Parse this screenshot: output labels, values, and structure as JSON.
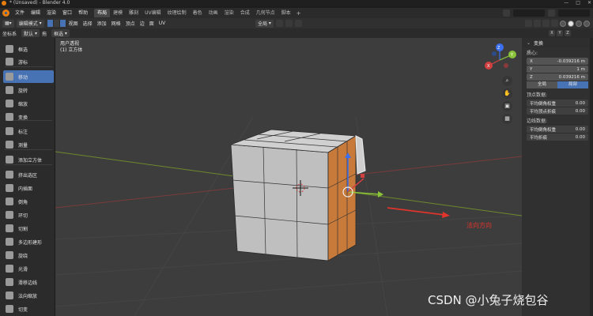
{
  "window": {
    "title": "* (Unsaved) - Blender 4.0",
    "controls": [
      "—",
      "□",
      "✕"
    ]
  },
  "menubar": {
    "menus": [
      "文件",
      "编辑",
      "渲染",
      "窗口",
      "帮助"
    ],
    "workspaces": [
      "布局",
      "建模",
      "雕刻",
      "UV编辑",
      "纹理绘制",
      "着色",
      "动画",
      "渲染",
      "合成",
      "几何节点",
      "脚本"
    ],
    "active_workspace": "布局",
    "add_tab": "+"
  },
  "viewport_header": {
    "mode": "编辑模式",
    "menus": [
      "视图",
      "选择",
      "添加",
      "网格",
      "顶点",
      "边",
      "面",
      "UV"
    ],
    "transform_orientation": "全局",
    "coord_label": "坐标系",
    "coord_value": "默认",
    "drag_label": "拖",
    "drag_value": "框选",
    "axis_labels": [
      "X",
      "Y",
      "Z"
    ]
  },
  "viewport": {
    "info_line1": "用户透视",
    "info_line2": "(1) 立方体",
    "annotation": "法向方向",
    "gizmo_axes": [
      "X",
      "Y",
      "Z"
    ]
  },
  "toolbar": {
    "tools": [
      {
        "label": "框选",
        "active": false
      },
      {
        "label": "游标",
        "active": false
      },
      {
        "label": "移动",
        "active": true
      },
      {
        "label": "旋转",
        "active": false
      },
      {
        "label": "缩放",
        "active": false
      },
      {
        "label": "变换",
        "active": false
      },
      {
        "label": "标注",
        "active": false
      },
      {
        "label": "测量",
        "active": false
      },
      {
        "label": "添加立方体",
        "active": false
      },
      {
        "label": "挤出选区",
        "active": false
      },
      {
        "label": "内插面",
        "active": false
      },
      {
        "label": "倒角",
        "active": false
      },
      {
        "label": "环切",
        "active": false
      },
      {
        "label": "切割",
        "active": false
      },
      {
        "label": "多边形建形",
        "active": false
      },
      {
        "label": "旋绕",
        "active": false
      },
      {
        "label": "光滑",
        "active": false
      },
      {
        "label": "滑移边线",
        "active": false
      },
      {
        "label": "法向缩放",
        "active": false
      },
      {
        "label": "切变",
        "active": false
      }
    ]
  },
  "npanel": {
    "header": "变换",
    "median_label": "质心:",
    "fields": [
      {
        "axis": "X",
        "value": "-0.039216 m"
      },
      {
        "axis": "Y",
        "value": "1 m"
      },
      {
        "axis": "Z",
        "value": "0.039216 m"
      }
    ],
    "toggles": [
      "全局",
      "局部"
    ],
    "active_toggle": "局部",
    "vertex_label": "顶点数据:",
    "vertex_fields": [
      {
        "label": "平均倒角权重",
        "value": "0.00"
      },
      {
        "label": "平均顶点折痕",
        "value": "0.00"
      }
    ],
    "edge_label": "边线数据:",
    "edge_fields": [
      {
        "label": "平均倒角权重",
        "value": "0.00"
      },
      {
        "label": "平均折痕",
        "value": "0.00"
      }
    ]
  },
  "watermark": "CSDN @小兔子烧包谷",
  "colors": {
    "accent": "#4772b3",
    "selected_face": "#c87a3a",
    "mesh": "#c8c8c8",
    "annotation_red": "#e0342c"
  }
}
